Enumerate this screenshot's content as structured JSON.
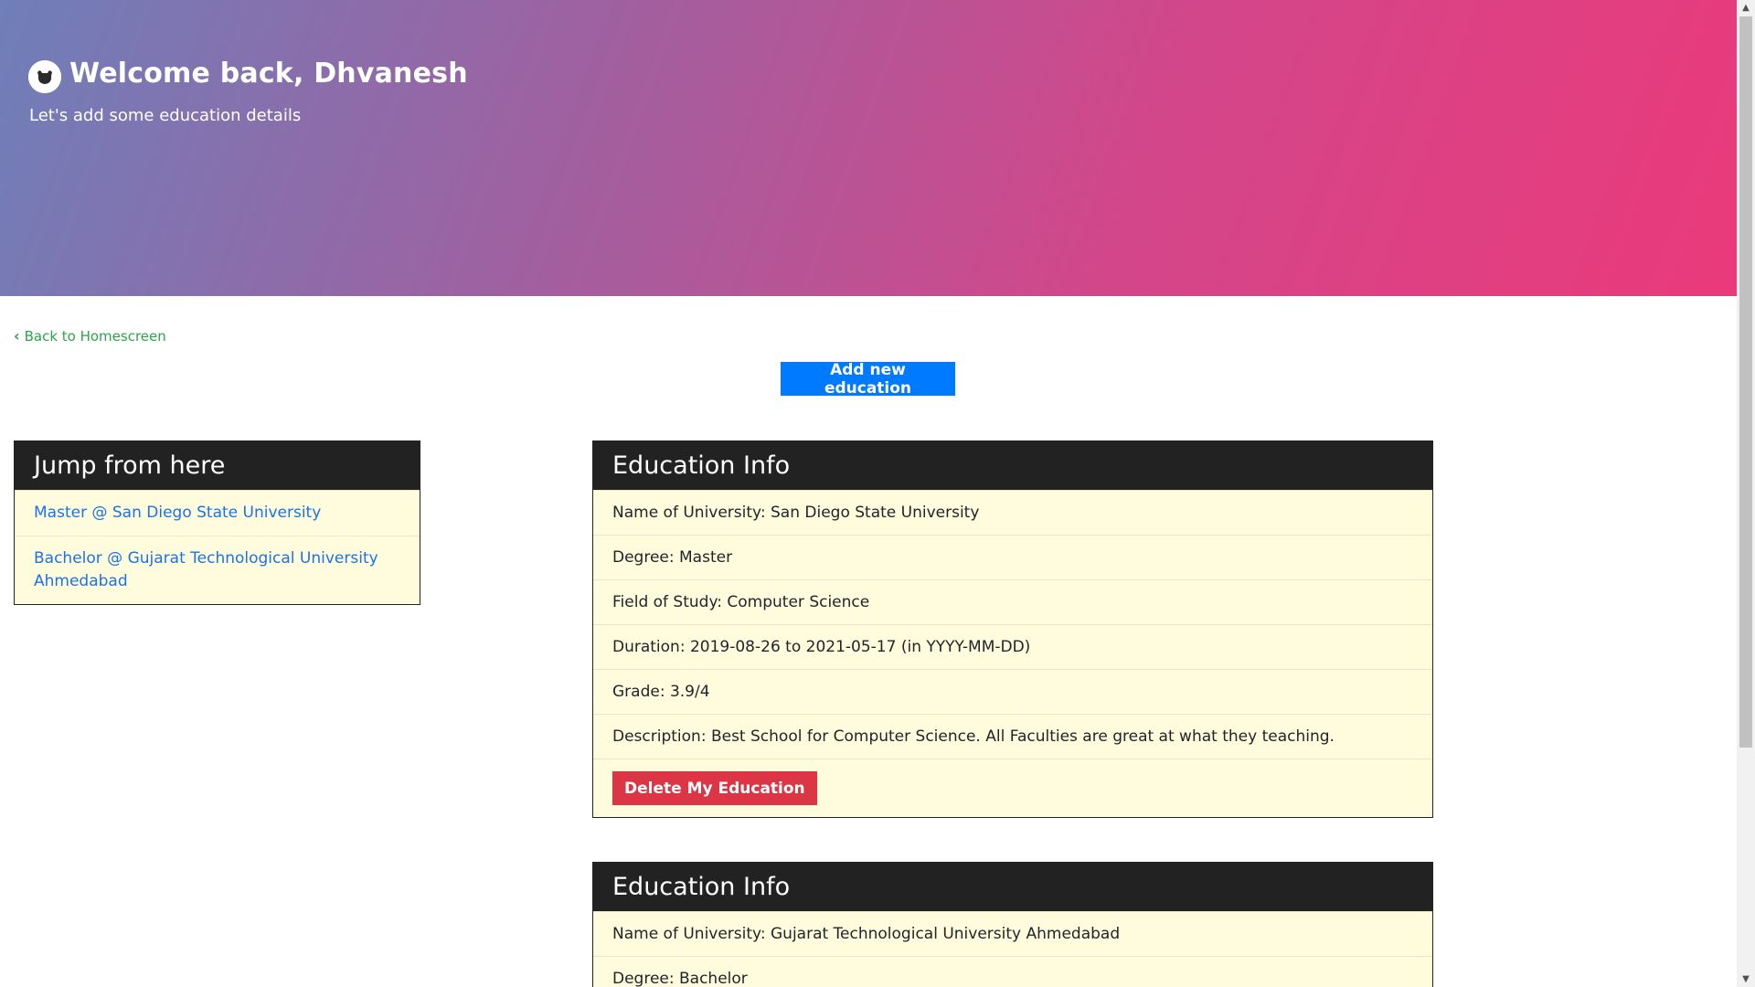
{
  "header": {
    "title": "Welcome back, Dhvanesh",
    "subtitle": "Let's add some education details",
    "avatar_icon": "user-avatar-icon"
  },
  "nav": {
    "back_label": "Back to Homescreen",
    "back_icon": "chevron-left-icon"
  },
  "actions": {
    "add_label": "Add new education"
  },
  "jump_panel": {
    "title": "Jump from here",
    "items": [
      "Master @ San Diego State University",
      "Bachelor @ Gujarat Technological University Ahmedabad"
    ]
  },
  "educations": [
    {
      "title": "Education Info",
      "university": "Name of University: San Diego State University",
      "degree": "Degree: Master",
      "field": "Field of Study: Computer Science",
      "duration": "Duration: 2019-08-26 to 2021-05-17 (in YYYY-MM-DD)",
      "grade": "Grade: 3.9/4",
      "description": "Description: Best School for Computer Science. All Faculties are great at what they teaching.",
      "delete_label": "Delete My Education"
    },
    {
      "title": "Education Info",
      "university": "Name of University: Gujarat Technological University Ahmedabad",
      "degree": "Degree: Bachelor"
    }
  ],
  "colors": {
    "gradient_start": "#6f7fb9",
    "gradient_end": "#ea3a7b",
    "primary_button": "#007bff",
    "danger_button": "#dc3545",
    "link_green": "#28a745",
    "link_blue": "#1a73e8",
    "card_background": "#fefcdc",
    "card_header": "#222222"
  }
}
